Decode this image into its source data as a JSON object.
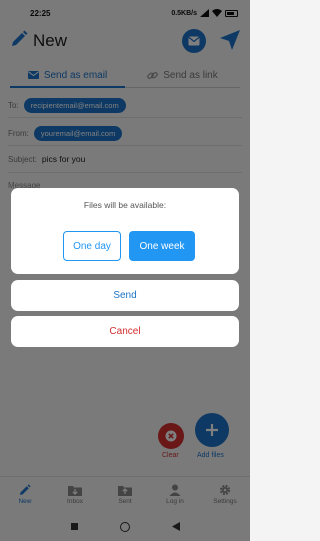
{
  "status_bar": {
    "time": "22:25",
    "speed": "0.5KB/s",
    "battery": ""
  },
  "header": {
    "title": "New"
  },
  "tabs": {
    "email_label": "Send as email",
    "link_label": "Send as link"
  },
  "form": {
    "to_label": "To:",
    "to_chip": "recipientemail@email.com",
    "from_label": "From:",
    "from_chip": "youremail@email.com",
    "subject_label": "Subject:",
    "subject_value": "pics for you",
    "message_label": "Message"
  },
  "fab": {
    "clear_label": "Clear",
    "add_label": "Add files"
  },
  "bottom_nav": {
    "items": [
      {
        "label": "New",
        "icon": "pencil-icon"
      },
      {
        "label": "Inbox",
        "icon": "inbox-icon"
      },
      {
        "label": "Sent",
        "icon": "sent-folder-icon"
      },
      {
        "label": "Log in",
        "icon": "person-icon"
      },
      {
        "label": "Settings",
        "icon": "gear-icon"
      }
    ]
  },
  "dialog": {
    "title": "Files will be available:",
    "option_one_day": "One day",
    "option_one_week": "One week",
    "selected": "One week",
    "send_label": "Send",
    "cancel_label": "Cancel"
  },
  "colors": {
    "accent": "#1a73c8",
    "danger": "#d32f2f",
    "option": "#2196f3"
  }
}
